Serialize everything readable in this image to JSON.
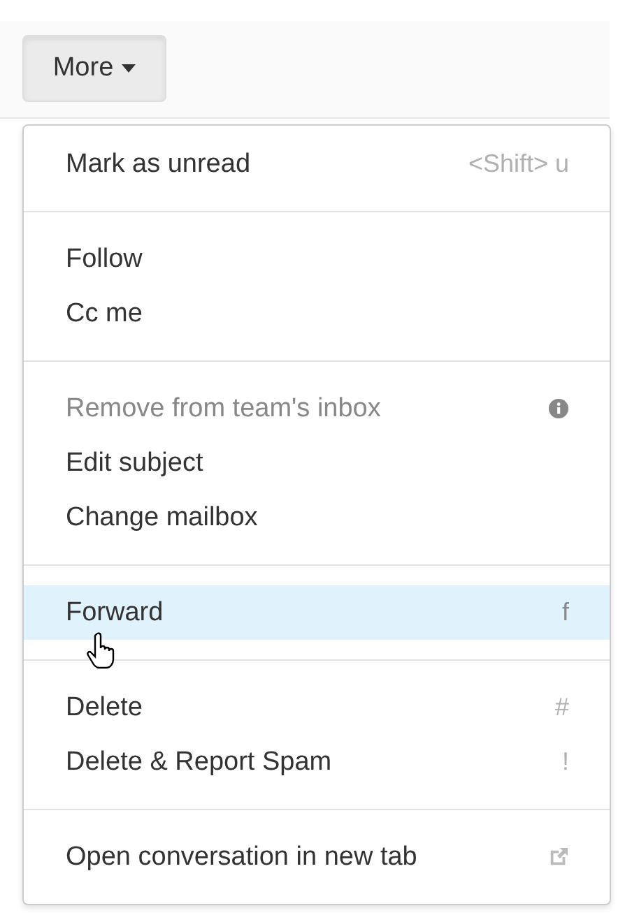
{
  "button": {
    "label": "More"
  },
  "menu": {
    "groups": [
      {
        "items": [
          {
            "kind": "shortcut",
            "label": "Mark as unread",
            "shortcut": "<Shift> u",
            "disabled": false,
            "selected": false
          }
        ]
      },
      {
        "items": [
          {
            "kind": "plain",
            "label": "Follow",
            "disabled": false,
            "selected": false
          },
          {
            "kind": "plain",
            "label": "Cc me",
            "disabled": false,
            "selected": false
          }
        ]
      },
      {
        "items": [
          {
            "kind": "info",
            "label": "Remove from team's inbox",
            "disabled": true,
            "selected": false
          },
          {
            "kind": "plain",
            "label": "Edit subject",
            "disabled": false,
            "selected": false
          },
          {
            "kind": "plain",
            "label": "Change mailbox",
            "disabled": false,
            "selected": false
          }
        ]
      },
      {
        "items": [
          {
            "kind": "shortcut",
            "label": "Forward",
            "shortcut": "f",
            "disabled": false,
            "selected": true
          }
        ]
      },
      {
        "items": [
          {
            "kind": "shortcut",
            "label": "Delete",
            "shortcut": "#",
            "disabled": false,
            "selected": false
          },
          {
            "kind": "shortcut",
            "label": "Delete & Report Spam",
            "shortcut": "!",
            "disabled": false,
            "selected": false
          }
        ]
      },
      {
        "items": [
          {
            "kind": "external",
            "label": "Open conversation in new tab",
            "disabled": false,
            "selected": false
          }
        ]
      }
    ]
  }
}
